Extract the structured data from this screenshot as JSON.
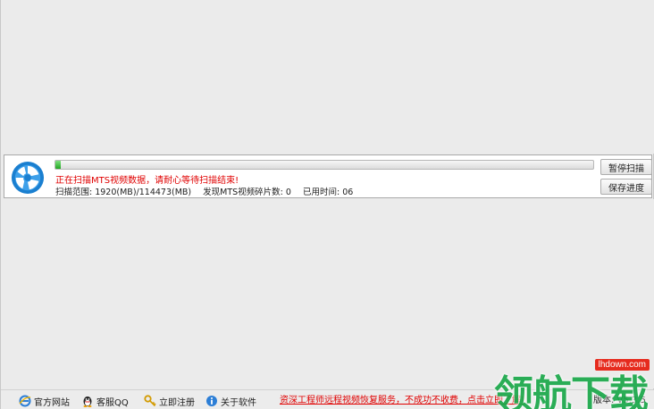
{
  "scan": {
    "progress_fraction": 0.01,
    "status_message": "正在扫描MTS视频数据，请耐心等待扫描结束!",
    "scan_range": "扫描范围: 1920(MB)/114473(MB)",
    "found_fragments": "发现MTS视频碎片数: 0",
    "elapsed_time": "已用时间: 06"
  },
  "buttons": {
    "pause_label": "暂停扫描",
    "save_label": "保存进度"
  },
  "footer": {
    "site_label": "官方网站",
    "qq_label": "客服QQ",
    "register_label": "立即注册",
    "about_label": "关于软件",
    "promo_text": "资深工程师远程视频恢复服务，不成功不收费，点击立即了解!",
    "version_text": "版本: V5.3.5"
  },
  "watermark": {
    "domain": "lhdown.com",
    "text": "领航下载"
  },
  "colors": {
    "accent_red": "#e00000",
    "progress_green": "#22a622",
    "logo_blue": "#1a7fd0",
    "watermark_green": "#1aa84a"
  }
}
